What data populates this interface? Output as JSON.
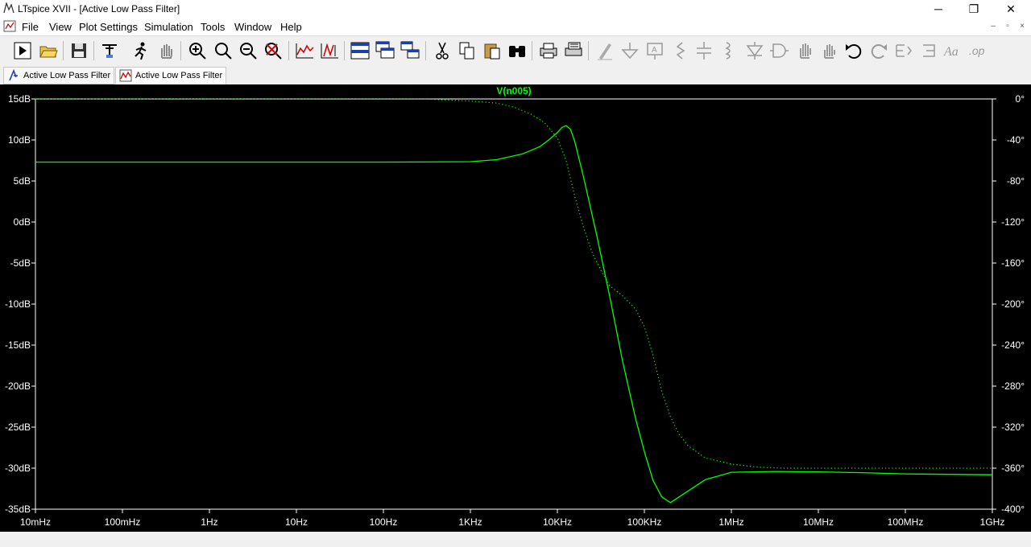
{
  "window": {
    "title": "LTspice XVII - [Active Low Pass Filter]",
    "minimize_glyph": "─",
    "restore_glyph": "❐",
    "close_glyph": "✕"
  },
  "menu": {
    "items": [
      "File",
      "View",
      "Plot Settings",
      "Simulation",
      "Tools",
      "Window",
      "Help"
    ],
    "mdi_minimize": "–",
    "mdi_restore": "▫",
    "mdi_close": "×"
  },
  "toolbar": {
    "buttons": [
      "run-icon",
      "open-icon",
      "save-icon",
      "control-panel-icon",
      "halt-icon",
      "pan-hand-icon",
      "zoom-in-icon",
      "zoom-area-icon",
      "zoom-out-icon",
      "zoom-cancel-icon",
      "autorange-icon",
      "add-trace-icon",
      "tile-vertical-icon",
      "cascade-icon",
      "tile-horizontal-icon",
      "cut-icon",
      "copy-icon",
      "paste-icon",
      "find-icon",
      "print-icon",
      "print-setup-icon",
      "draw-wire-icon",
      "ground-icon",
      "label-net-icon",
      "resistor-icon",
      "capacitor-icon",
      "inductor-icon",
      "diode-icon",
      "component-icon",
      "move-icon",
      "drag-icon",
      "undo-icon",
      "redo-icon",
      "rotate-icon",
      "mirror-icon",
      "text-icon",
      "spice-directive-icon"
    ]
  },
  "tabs": [
    {
      "label": "Active Low Pass Filter",
      "icon": "schematic-icon",
      "active": false
    },
    {
      "label": "Active Low Pass Filter",
      "icon": "waveform-icon",
      "active": true
    }
  ],
  "plot": {
    "trace_name": "V(n005)",
    "trace_color": "#00ff00",
    "background": "#000000",
    "axis_color": "#ffffff"
  },
  "chart_data": {
    "type": "line",
    "title": "",
    "xlabel": "",
    "ylabel": "",
    "x_scale": "log",
    "x_ticks": [
      "10mHz",
      "100mHz",
      "1Hz",
      "10Hz",
      "100Hz",
      "1KHz",
      "10KHz",
      "100KHz",
      "1MHz",
      "10MHz",
      "100MHz",
      "1GHz"
    ],
    "y_ticks": [
      "15dB",
      "10dB",
      "5dB",
      "0dB",
      "-5dB",
      "-10dB",
      "-15dB",
      "-20dB",
      "-25dB",
      "-30dB",
      "-35dB"
    ],
    "y2_ticks": [
      "0°",
      "-40°",
      "-80°",
      "-120°",
      "-160°",
      "-200°",
      "-240°",
      "-280°",
      "-320°",
      "-360°",
      "-400°"
    ],
    "ylim": [
      -35,
      15
    ],
    "y2lim": [
      -400,
      0
    ],
    "grid": false,
    "series": [
      {
        "name": "V(n005)",
        "axis": "magnitude",
        "style": "solid",
        "x_log10": [
          -2,
          2,
          3,
          3.3,
          3.6,
          3.8,
          3.9,
          4.0,
          4.05,
          4.1,
          4.15,
          4.2,
          4.3,
          4.45,
          4.6,
          4.75,
          4.9,
          5.0,
          5.1,
          5.2,
          5.3,
          5.5,
          5.7,
          6.0,
          6.5,
          7.0,
          7.5,
          8.0,
          9.0
        ],
        "values": [
          7.3,
          7.3,
          7.35,
          7.6,
          8.3,
          9.2,
          10.0,
          10.9,
          11.5,
          11.75,
          11.3,
          9.8,
          5.5,
          -1.5,
          -9,
          -17,
          -24,
          -28,
          -31.5,
          -33.5,
          -34.2,
          -32.8,
          -31.4,
          -30.5,
          -30.4,
          -30.45,
          -30.55,
          -30.7,
          -30.8
        ]
      },
      {
        "name": "V(n005)",
        "axis": "phase",
        "style": "dotted",
        "x_log10": [
          -2,
          2.5,
          3.0,
          3.3,
          3.5,
          3.7,
          3.85,
          4.0,
          4.1,
          4.2,
          4.3,
          4.4,
          4.5,
          4.6,
          4.75,
          4.9,
          5.0,
          5.1,
          5.2,
          5.3,
          5.4,
          5.5,
          5.7,
          6.0,
          6.3,
          6.6,
          7.0,
          8.0,
          9.0
        ],
        "values": [
          0,
          -0.2,
          -2,
          -4,
          -8,
          -15,
          -23,
          -38,
          -60,
          -95,
          -125,
          -150,
          -167,
          -182,
          -192,
          -205,
          -222,
          -250,
          -285,
          -310,
          -327,
          -338,
          -350,
          -356,
          -359,
          -360,
          -360,
          -360,
          -360
        ]
      }
    ]
  }
}
